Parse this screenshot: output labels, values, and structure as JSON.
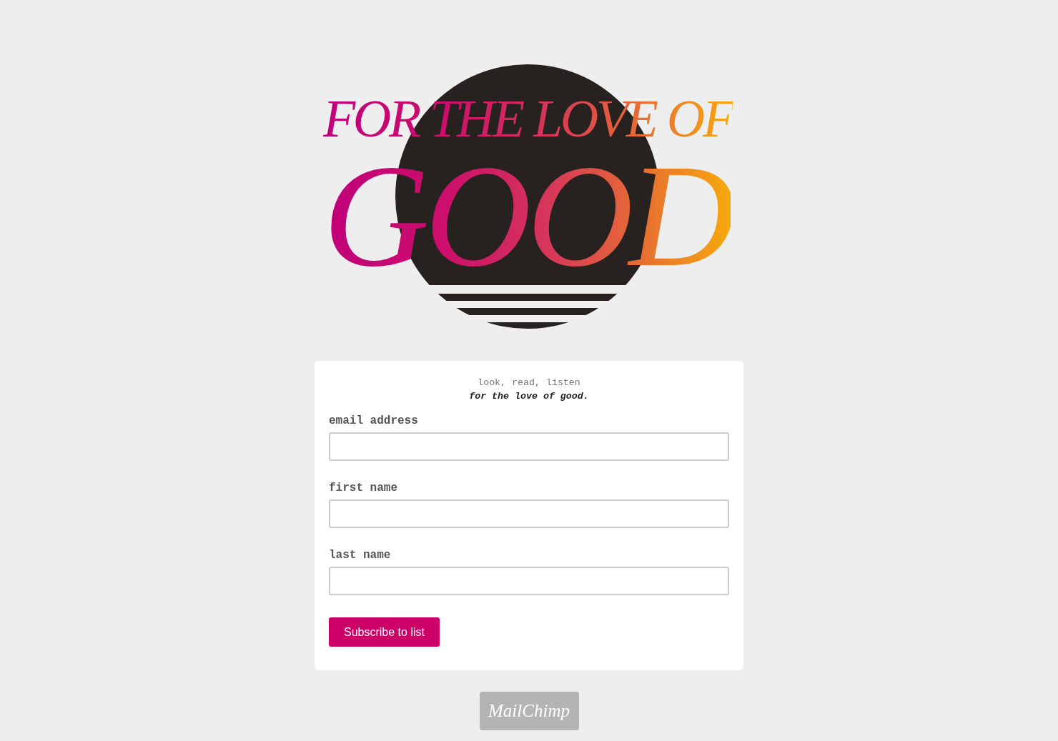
{
  "logo": {
    "line_1": "FOR THE LOVE OF",
    "line_2": "GOOD"
  },
  "form": {
    "intro": "look, read, listen",
    "subtitle": "for the love of good.",
    "fields": [
      {
        "label": "email address"
      },
      {
        "label": "first name"
      },
      {
        "label": "last name"
      }
    ],
    "submit": "Subscribe to list"
  },
  "footer": {
    "badge": "MailChimp"
  }
}
